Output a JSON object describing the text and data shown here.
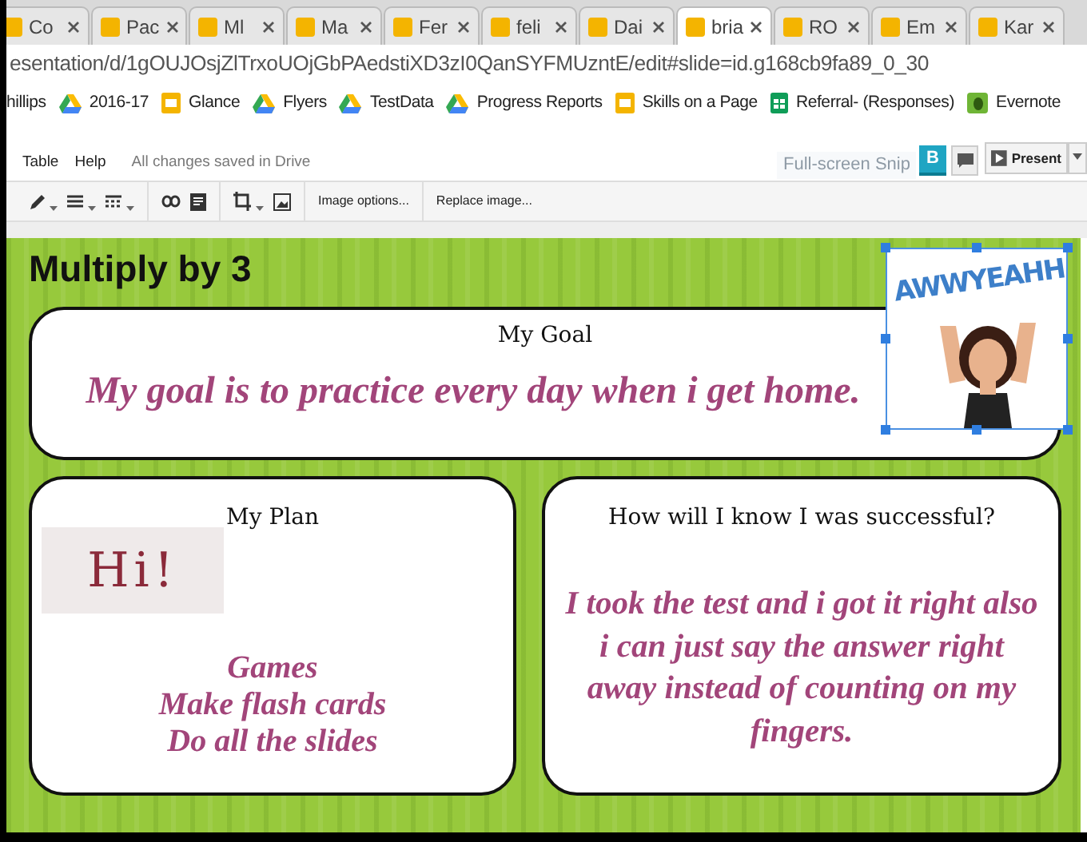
{
  "browser": {
    "tabs": [
      {
        "label": "Co",
        "selected": false
      },
      {
        "label": "Pac",
        "selected": false
      },
      {
        "label": "Ml",
        "selected": false
      },
      {
        "label": "Ma",
        "selected": false
      },
      {
        "label": "Fer",
        "selected": false
      },
      {
        "label": "feli",
        "selected": false
      },
      {
        "label": "Dai",
        "selected": false
      },
      {
        "label": "bria",
        "selected": true
      },
      {
        "label": "RO",
        "selected": false
      },
      {
        "label": "Em",
        "selected": false
      },
      {
        "label": "Kar",
        "selected": false
      }
    ],
    "address": "esentation/d/1gOUJOsjZlTrxoUOjGbPAedstiXD3zI0QanSYFMUzntE/edit#slide=id.g168cb9fa89_0_30",
    "bookmarks": [
      {
        "label": "hillips",
        "kind": "plain"
      },
      {
        "label": "2016-17",
        "kind": "drive"
      },
      {
        "label": "Glance",
        "kind": "slides"
      },
      {
        "label": "Flyers",
        "kind": "drive"
      },
      {
        "label": "TestData",
        "kind": "drive"
      },
      {
        "label": "Progress Reports",
        "kind": "drive"
      },
      {
        "label": "Skills on a Page",
        "kind": "slides"
      },
      {
        "label": "Referral- (Responses)",
        "kind": "sheets"
      },
      {
        "label": "Evernote",
        "kind": "evernote"
      }
    ]
  },
  "editor": {
    "menu": [
      "Table",
      "Help"
    ],
    "save_status": "All changes saved in Drive",
    "overlay_hint": "Full-screen Snip",
    "toolbar_buttons": [
      "Image options...",
      "Replace image..."
    ],
    "account_initial": "B",
    "present_label": "Present"
  },
  "slide": {
    "title": "Multiply by 3",
    "goal": {
      "heading": "My Goal",
      "text": "My goal is to practice every day when i get home."
    },
    "sticker": {
      "caption": "AWWYEAHH",
      "selected": true
    },
    "plan": {
      "heading": "My Plan",
      "badge": "Hi!",
      "items": [
        "Games",
        "Make flash cards",
        "Do all the slides"
      ]
    },
    "success": {
      "heading": "How will I know I was successful?",
      "text": "I took the test and i got it right also i can just say the answer right away instead of counting on my fingers."
    }
  }
}
